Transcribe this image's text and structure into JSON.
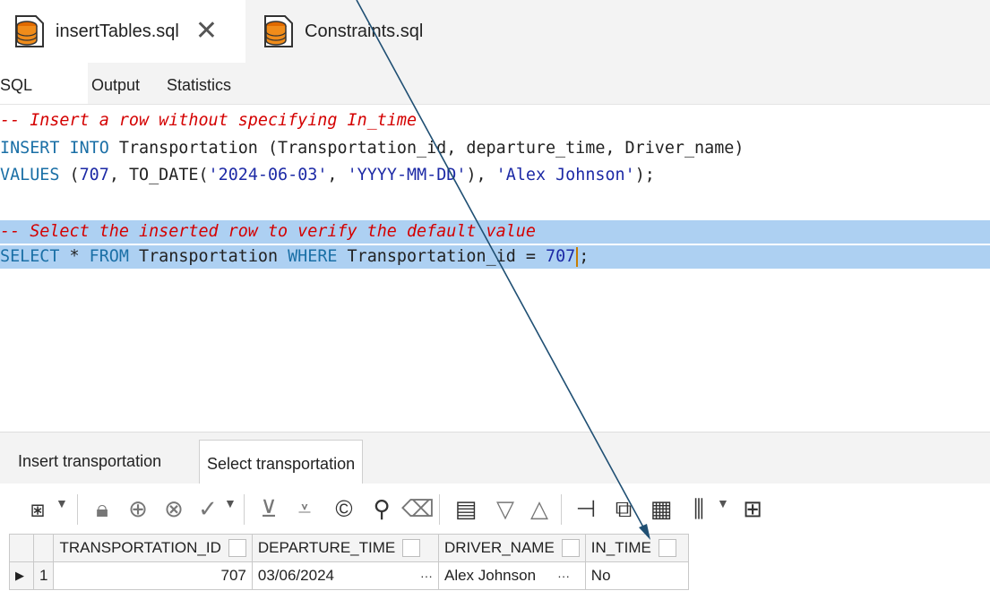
{
  "file_tabs": [
    {
      "label": "insertTables.sql",
      "icon": "database-file-icon",
      "close_icon": "close-icon"
    },
    {
      "label": "Constraints.sql",
      "icon": "database-file-icon"
    }
  ],
  "sql_tabs": [
    "SQL",
    "Output",
    "Statistics"
  ],
  "editor": {
    "line1": "-- Insert a row without specifying In_time",
    "line2": {
      "kw1": "INSERT INTO",
      "rest": " Transportation (Transportation_id, departure_time, Driver_name)"
    },
    "line3": {
      "kw": "VALUES",
      "p1": " (",
      "n1": "707",
      "p2": ", TO_DATE(",
      "s1": "'2024-06-03'",
      "p3": ", ",
      "s2": "'YYYY-MM-DD'",
      "p4": "), ",
      "s3": "'Alex Johnson'",
      "p5": ");"
    },
    "line4": "-- Select the inserted row to verify the default value",
    "line5": {
      "kw1": "SELECT",
      "p1": " * ",
      "kw2": "FROM",
      "p2": " Transportation ",
      "kw3": "WHERE",
      "p3": " Transportation_id = ",
      "n1": "707",
      "p4": ";"
    }
  },
  "result_tabs": [
    "Insert transportation",
    "Select transportation"
  ],
  "toolbar_icons": [
    "grid-settings-icon",
    "lock-icon",
    "add-row-icon",
    "delete-row-icon",
    "apply-check-icon",
    "scroll-down-icon",
    "fetch-all-icon",
    "refresh-icon",
    "find-icon",
    "clear-icon",
    "export-icon",
    "filter-down-icon",
    "filter-up-icon",
    "tree-icon",
    "copy-icon",
    "import-icon",
    "chart-icon",
    "layout-icon"
  ],
  "grid": {
    "headers": [
      "TRANSPORTATION_ID",
      "DEPARTURE_TIME",
      "DRIVER_NAME",
      "IN_TIME"
    ],
    "rows": [
      {
        "index": "1",
        "transportation_id": "707",
        "departure_time": "03/06/2024",
        "driver_name": "Alex Johnson",
        "in_time": "No"
      }
    ]
  },
  "colors": {
    "selection": "#add0f2",
    "keyword": "#1a6fa6",
    "comment": "#d40000",
    "string": "#1d2aa6",
    "arrow": "#1f4f73"
  }
}
